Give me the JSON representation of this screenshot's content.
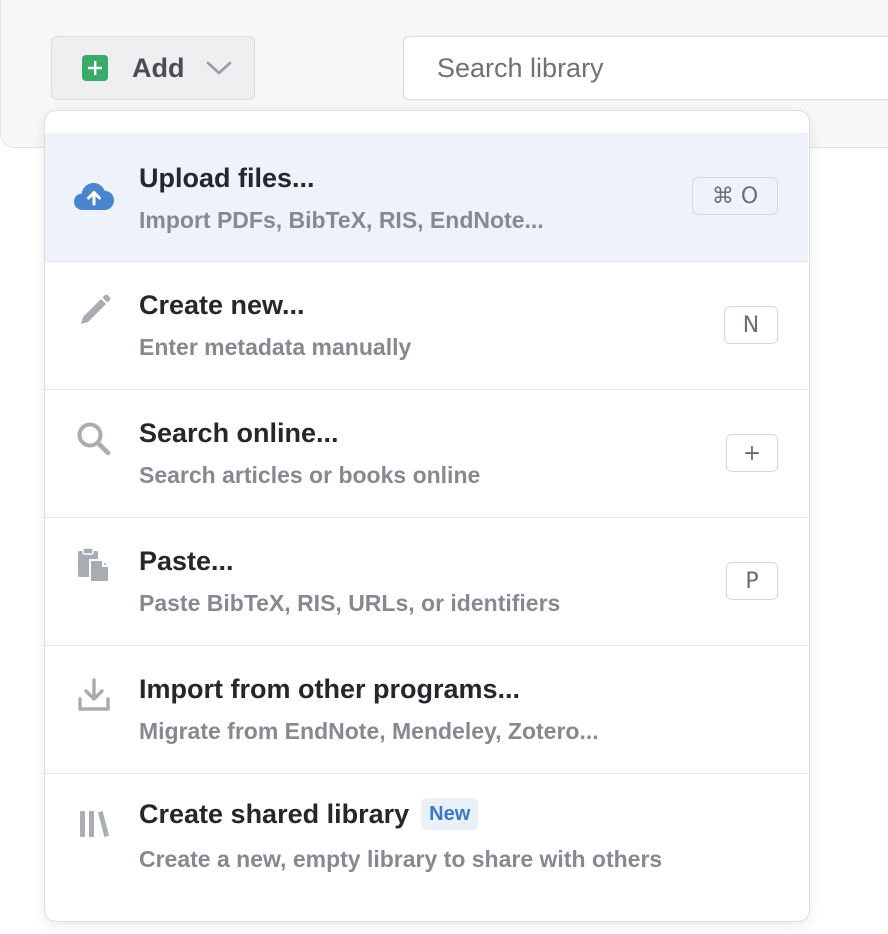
{
  "toolbar": {
    "add_label": "Add",
    "search_placeholder": "Search library"
  },
  "colors": {
    "add_icon": "#3aaa6a",
    "upload_icon": "#4a86d0",
    "highlight_row": "#edf2fb",
    "badge_text": "#3b78c4"
  },
  "menu": {
    "items": [
      {
        "icon": "cloud-upload-icon",
        "title": "Upload files...",
        "subtitle": "Import PDFs, BibTeX, RIS, EndNote...",
        "shortcut": "⌘ O"
      },
      {
        "icon": "pencil-icon",
        "title": "Create new...",
        "subtitle": "Enter metadata manually",
        "shortcut": "N"
      },
      {
        "icon": "search-icon",
        "title": "Search online...",
        "subtitle": "Search articles or books online",
        "shortcut": "+"
      },
      {
        "icon": "clipboard-paste-icon",
        "title": "Paste...",
        "subtitle": "Paste BibTeX, RIS, URLs, or identifiers",
        "shortcut": "P"
      },
      {
        "icon": "download-tray-icon",
        "title": "Import from other programs...",
        "subtitle": "Migrate from EndNote, Mendeley, Zotero..."
      },
      {
        "icon": "library-books-icon",
        "title": "Create shared library",
        "badge": "New",
        "subtitle": "Create a new, empty library to share with others"
      }
    ]
  }
}
